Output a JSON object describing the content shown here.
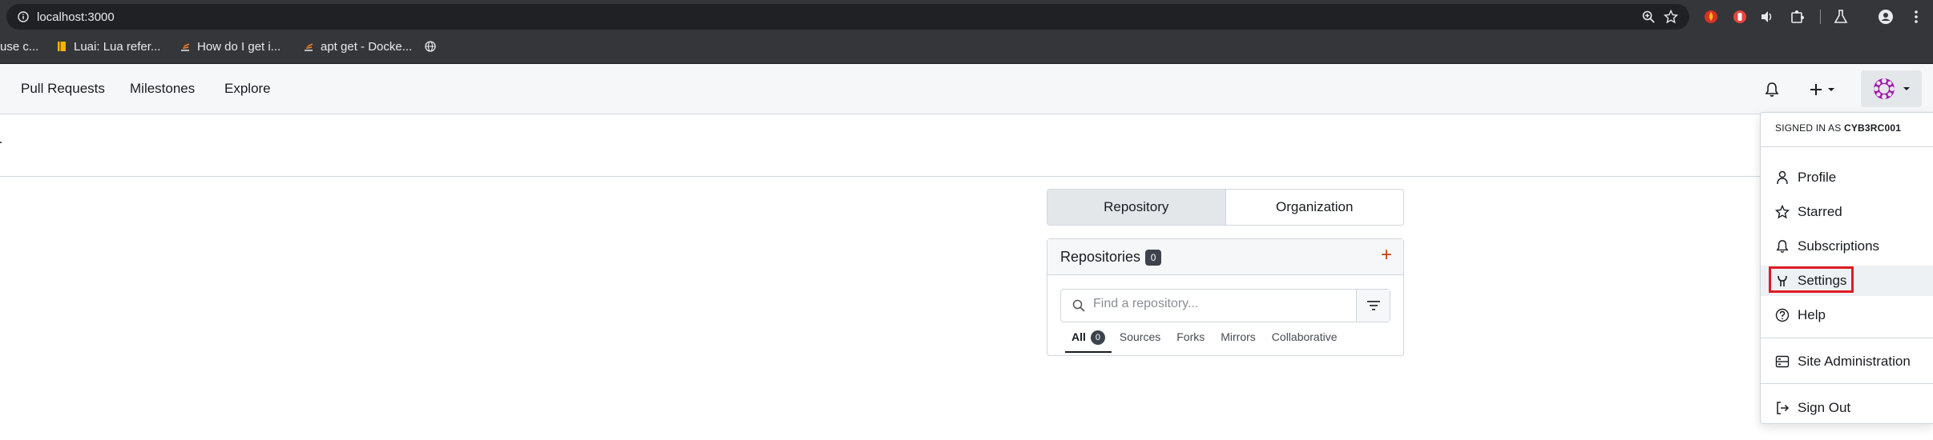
{
  "browser": {
    "url": "localhost:3000",
    "bookmarks": [
      {
        "label": "use c...",
        "icon": "none"
      },
      {
        "label": "Luai: Lua refer...",
        "icon": "book-icon"
      },
      {
        "label": "How do I get i...",
        "icon": "stackoverflow-icon"
      },
      {
        "label": "apt get - Docke...",
        "icon": "stackoverflow-icon"
      },
      {
        "label": "",
        "icon": "globe-icon"
      }
    ]
  },
  "navbar": {
    "links": [
      "Pull Requests",
      "Milestones",
      "Explore"
    ]
  },
  "dashboard": {
    "switch": {
      "repository": "Repository",
      "organization": "Organization"
    },
    "repos": {
      "title": "Repositories",
      "count": "0",
      "search_placeholder": "Find a repository...",
      "tabs": {
        "all": "All",
        "all_count": "0",
        "sources": "Sources",
        "forks": "Forks",
        "mirrors": "Mirrors",
        "collaborative": "Collaborative"
      }
    }
  },
  "user_menu": {
    "signed_in_prefix": "SIGNED IN AS ",
    "username": "CYB3RC001",
    "items": {
      "profile": "Profile",
      "starred": "Starred",
      "subscriptions": "Subscriptions",
      "settings": "Settings",
      "help": "Help",
      "site_admin": "Site Administration",
      "sign_out": "Sign Out"
    }
  },
  "colors": {
    "accent": "#c2410c",
    "highlight": "#e01b24",
    "avatar": "#a21caf"
  }
}
